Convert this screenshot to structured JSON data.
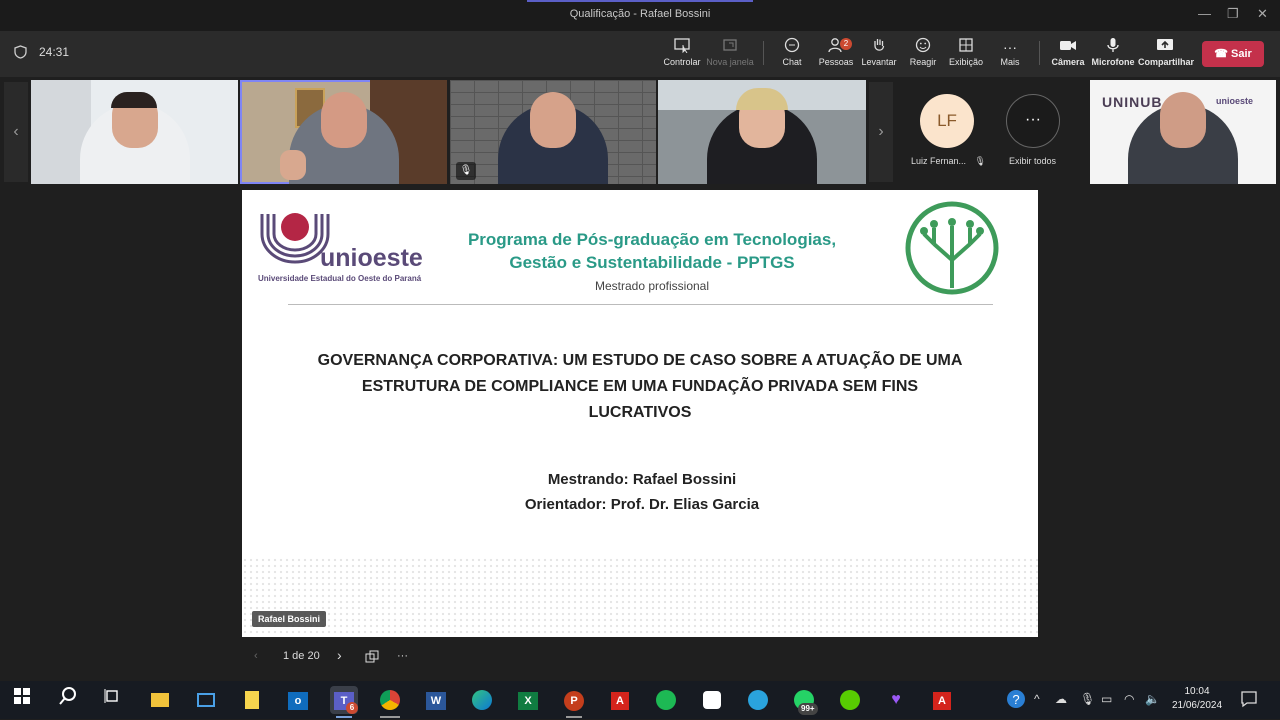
{
  "window": {
    "title": "Qualificação - Rafael Bossini",
    "minimize": "—",
    "restore": "❐",
    "close": "✕"
  },
  "toolbar": {
    "timer": "24:31",
    "controlar": "Controlar",
    "nova_janela": "Nova janela",
    "chat": "Chat",
    "pessoas": "Pessoas",
    "pessoas_badge": "2",
    "levantar": "Levantar",
    "reagir": "Reagir",
    "exibicao": "Exibição",
    "mais": "Mais",
    "camera": "Câmera",
    "microfone": "Microfone",
    "compartilhar": "Compartilhar",
    "sair": "Sair"
  },
  "participants": {
    "initials": "LF",
    "name": "Luiz Fernan...",
    "view_all": "Exibir todos"
  },
  "self_tile": {
    "logo_text": "UNINUB",
    "logo_text_right": "unioeste"
  },
  "slide": {
    "uni_name": "unioeste",
    "uni_full": "Universidade Estadual do Oeste do Paraná",
    "program_line1": "Programa de Pós-graduação em Tecnologias,",
    "program_line2": "Gestão e Sustentabilidade - PPTGS",
    "program_line3": "Mestrado profissional",
    "thesis_title": "GOVERNANÇA CORPORATIVA: UM ESTUDO DE CASO SOBRE A ATUAÇÃO DE UMA ESTRUTURA DE COMPLIANCE EM UMA FUNDAÇÃO PRIVADA SEM FINS LUCRATIVOS",
    "student": "Mestrando: Rafael Bossini",
    "advisor": "Orientador: Prof. Dr. Elias Garcia",
    "presenter": "Rafael Bossini"
  },
  "slide_nav": {
    "page": "1 de 20"
  },
  "taskbar": {
    "teams_badge": "6",
    "whatsapp_badge": "99+",
    "time": "10:04",
    "date": "21/06/2024"
  },
  "colors": {
    "leave_red": "#c4314b",
    "teams_accent": "#7f85f5",
    "program_green": "#2a9a87",
    "unioeste_purple": "#5a4a78"
  }
}
